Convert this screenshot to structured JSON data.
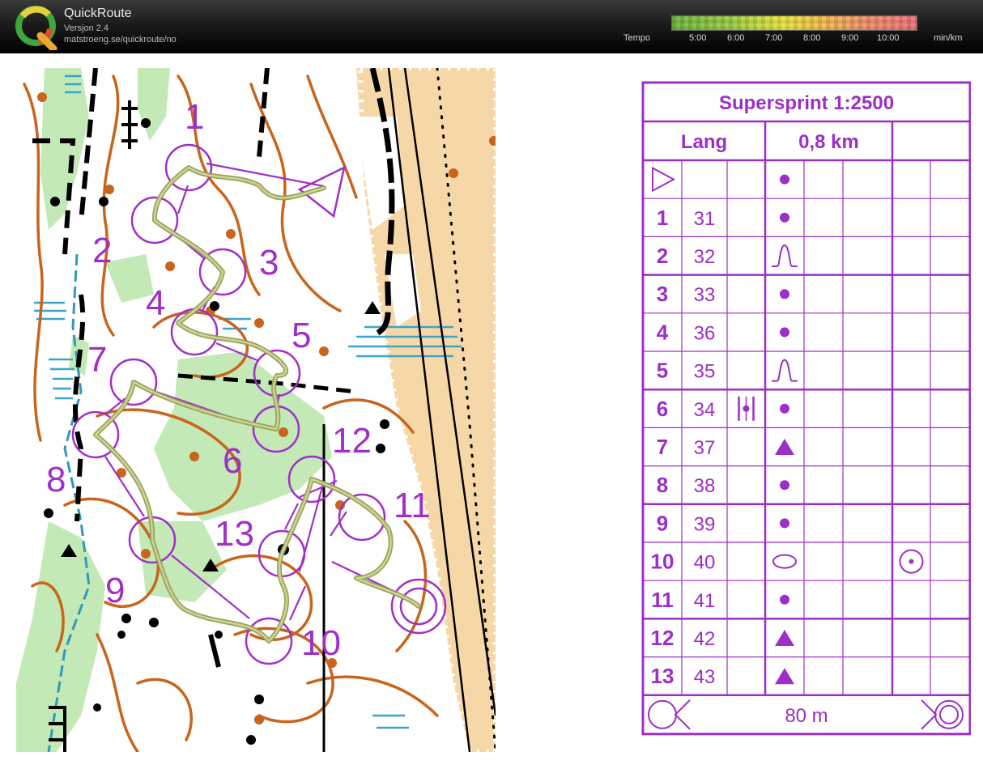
{
  "app": {
    "title": "QuickRoute",
    "version": "Versjon 2.4",
    "url": "matstroeng.se/quickroute/no"
  },
  "legend": {
    "label": "Tempo",
    "ticks": [
      "5:00",
      "6:00",
      "7:00",
      "8:00",
      "9:00",
      "10:00"
    ],
    "unit": "min/km"
  },
  "map": {
    "control_numbers": [
      "1",
      "2",
      "3",
      "4",
      "5",
      "6",
      "7",
      "8",
      "9",
      "10",
      "11",
      "12",
      "13"
    ],
    "colors": {
      "course": "#a02fc8",
      "contour": "#c8651b",
      "vegetation": "#bfe8b4",
      "route_low": "#7fb852",
      "route_high": "#e28a5c"
    }
  },
  "description_sheet": {
    "title": "Supersprint 1:2500",
    "class": "Lang",
    "length": "0,8 km",
    "start_symbol": "start-triangle-icon",
    "start_feature": "dot-icon",
    "controls": [
      {
        "num": "1",
        "code": "31",
        "which": "",
        "feature": "dot-icon"
      },
      {
        "num": "2",
        "code": "32",
        "which": "",
        "feature": "bell-icon"
      },
      {
        "num": "3",
        "code": "33",
        "which": "",
        "feature": "dot-icon"
      },
      {
        "num": "4",
        "code": "36",
        "which": "",
        "feature": "dot-icon"
      },
      {
        "num": "5",
        "code": "35",
        "which": "",
        "feature": "bell-icon"
      },
      {
        "num": "6",
        "code": "34",
        "which": "between-icon",
        "feature": "dot-icon"
      },
      {
        "num": "7",
        "code": "37",
        "which": "",
        "feature": "triangle-icon"
      },
      {
        "num": "8",
        "code": "38",
        "which": "",
        "feature": "dot-icon"
      },
      {
        "num": "9",
        "code": "39",
        "which": "",
        "feature": "dot-icon"
      },
      {
        "num": "10",
        "code": "40",
        "which": "",
        "feature": "ellipse-icon",
        "extra": "circle-dot-icon"
      },
      {
        "num": "11",
        "code": "41",
        "which": "",
        "feature": "dot-icon"
      },
      {
        "num": "12",
        "code": "42",
        "which": "",
        "feature": "triangle-icon"
      },
      {
        "num": "13",
        "code": "43",
        "which": "",
        "feature": "triangle-icon"
      }
    ],
    "finish_distance": "80 m"
  }
}
